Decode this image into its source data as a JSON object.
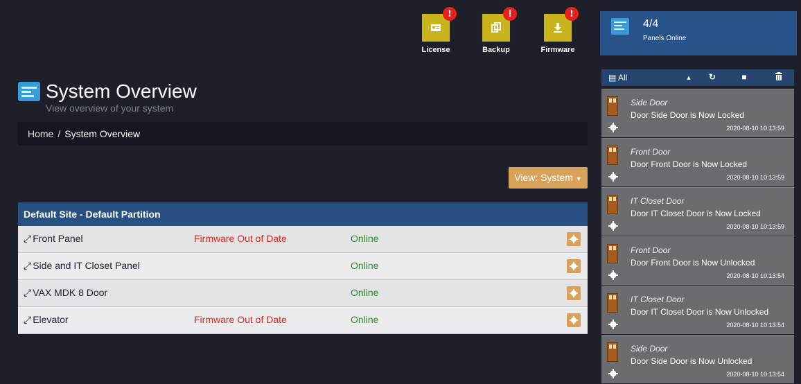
{
  "toolbar": {
    "items": [
      {
        "label": "License",
        "badge": "!",
        "icon": "id-card-icon"
      },
      {
        "label": "Backup",
        "badge": "!",
        "icon": "copy-icon"
      },
      {
        "label": "Firmware",
        "badge": "!",
        "icon": "download-icon"
      }
    ]
  },
  "header": {
    "title": "System Overview",
    "subtitle": "View overview of your system"
  },
  "breadcrumb": {
    "home": "Home",
    "separator": "/",
    "current": "System Overview"
  },
  "view_button": "View: System",
  "panel_group": {
    "title": "Default Site - Default Partition",
    "rows": [
      {
        "name": "Front Panel",
        "firmware": "Firmware Out of Date",
        "status": "Online"
      },
      {
        "name": "Side and IT Closet Panel",
        "firmware": "",
        "status": "Online"
      },
      {
        "name": "VAX MDK 8 Door",
        "firmware": "",
        "status": "Online"
      },
      {
        "name": "Elevator",
        "firmware": "Firmware Out of Date",
        "status": "Online"
      }
    ]
  },
  "status_card": {
    "value": "4/4",
    "label": "Panels Online"
  },
  "events_toolbar": {
    "filter_label": "All"
  },
  "events": [
    {
      "title": "Side Door",
      "message": "Door Side Door is Now Locked",
      "time": "2020-08-10 10:13:59"
    },
    {
      "title": "Front Door",
      "message": "Door Front Door is Now Locked",
      "time": "2020-08-10 10:13:59"
    },
    {
      "title": "IT Closet Door",
      "message": "Door IT Closet Door is Now Locked",
      "time": "2020-08-10 10:13:59"
    },
    {
      "title": "Front Door",
      "message": "Door Front Door is Now Unlocked",
      "time": "2020-08-10 10:13:54"
    },
    {
      "title": "IT Closet Door",
      "message": "Door IT Closet Door is Now Unlocked",
      "time": "2020-08-10 10:13:54"
    },
    {
      "title": "Side Door",
      "message": "Door Side Door is Now Unlocked",
      "time": "2020-08-10 10:13:54"
    }
  ],
  "colors": {
    "background": "#1d2029",
    "accent_blue": "#28528a",
    "tool_yellow": "#c9b41d",
    "warning_red": "#e0241a",
    "online_green": "#2f8a2f",
    "action_orange": "#d9a25b"
  }
}
